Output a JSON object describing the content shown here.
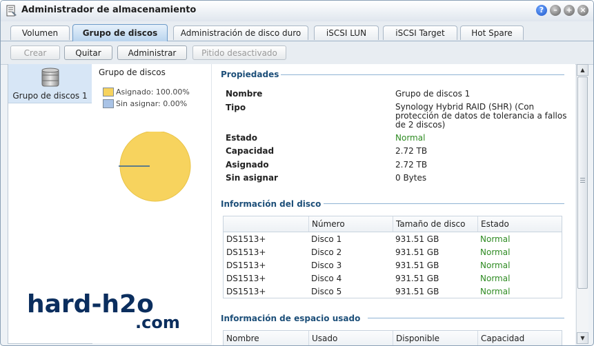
{
  "window": {
    "title": "Administrador de almacenamiento",
    "buttons": [
      "help-icon",
      "minimize-icon",
      "maximize-icon",
      "close-icon"
    ]
  },
  "tabs": [
    {
      "label": "Volumen",
      "active": false
    },
    {
      "label": "Grupo de discos",
      "active": true
    },
    {
      "label": "Administración de disco duro",
      "active": false
    },
    {
      "label": "iSCSI LUN",
      "active": false
    },
    {
      "label": "iSCSI Target",
      "active": false
    },
    {
      "label": "Hot Spare",
      "active": false
    }
  ],
  "toolbar": {
    "create": "Crear",
    "remove": "Quitar",
    "manage": "Administrar",
    "beep": "Pitido desactivado"
  },
  "sidebar": {
    "items": [
      {
        "label": "Grupo de discos 1",
        "icon": "disk-stack-icon",
        "selected": true
      }
    ]
  },
  "usage": {
    "title": "Grupo de discos",
    "assigned_label": "Asignado: 100.00%",
    "unassigned_label": "Sin asignar: 0.00%",
    "assigned_fraction": 1.0,
    "assigned_color": "#f7d35e",
    "unassigned_color": "#a9c3e6"
  },
  "properties": {
    "heading": "Propiedades",
    "rows": [
      {
        "label": "Nombre",
        "value": "Grupo de discos 1"
      },
      {
        "label": "Tipo",
        "value": "Synology Hybrid RAID (SHR) (Con protección de datos de tolerancia a fallos de 2 discos)"
      },
      {
        "label": "Estado",
        "value": "Normal"
      },
      {
        "label": "Capacidad",
        "value": "2.72 TB"
      },
      {
        "label": "Asignado",
        "value": "2.72 TB"
      },
      {
        "label": "Sin asignar",
        "value": "0 Bytes"
      }
    ]
  },
  "disk_info": {
    "heading": "Información del disco",
    "columns": [
      "",
      "Número",
      "Tamaño de disco",
      "Estado"
    ],
    "rows": [
      [
        "DS1513+",
        "Disco 1",
        "931.51 GB",
        "Normal"
      ],
      [
        "DS1513+",
        "Disco 2",
        "931.51 GB",
        "Normal"
      ],
      [
        "DS1513+",
        "Disco 3",
        "931.51 GB",
        "Normal"
      ],
      [
        "DS1513+",
        "Disco 4",
        "931.51 GB",
        "Normal"
      ],
      [
        "DS1513+",
        "Disco 5",
        "931.51 GB",
        "Normal"
      ]
    ]
  },
  "space_info": {
    "heading": "Información de espacio usado",
    "columns": [
      "Nombre",
      "Usado",
      "Disponible",
      "Capacidad"
    ]
  },
  "watermark": {
    "line1": "hard-h2o",
    "line2": ".com"
  },
  "colors": {
    "status_normal": "#2e8b22",
    "section_heading": "#1d4f79",
    "active_tab": "#b9d4ee"
  }
}
